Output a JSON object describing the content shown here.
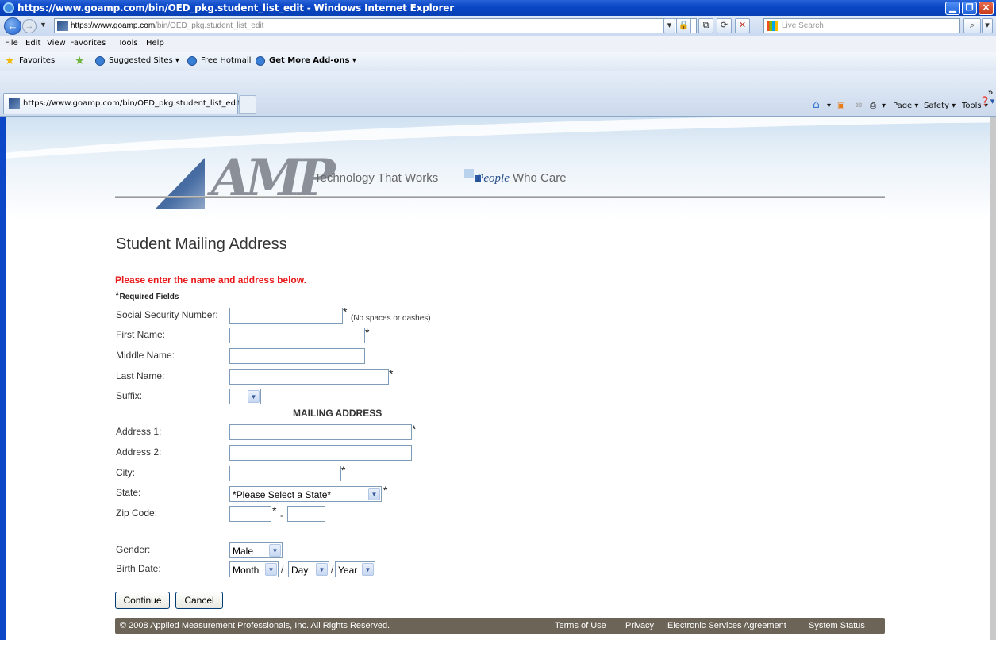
{
  "window": {
    "title": "https://www.goamp.com/bin/OED_pkg.student_list_edit - Windows Internet Explorer",
    "min_glyph": "▁",
    "max_glyph": "❐",
    "close_glyph": "✕"
  },
  "address_bar": {
    "url_prefix": "https://",
    "url_domain": "www.goamp.com",
    "url_path": "/bin/OED_pkg.student_list_edit",
    "search_placeholder": "Live Search"
  },
  "menu": [
    "File",
    "Edit",
    "View",
    "Favorites",
    "Tools",
    "Help"
  ],
  "favorites_bar": {
    "favorites_label": "Favorites",
    "suggested_sites": "Suggested Sites ▾",
    "free_hotmail": "Free Hotmail",
    "get_more_addons": "Get More Add-ons ▾"
  },
  "tab": {
    "label": "https://www.goamp.com/bin/OED_pkg.student_list_edit"
  },
  "command_bar": {
    "page": "Page ▾",
    "safety": "Safety ▾",
    "tools": "Tools ▾",
    "help": "❓▾",
    "more": "»"
  },
  "banner": {
    "logo_text": "AMP",
    "tagline_a": "Technology That Works",
    "tagline_b": "People",
    "tagline_c": " Who Care"
  },
  "form": {
    "heading": "Student Mailing Address",
    "instruction": "Please enter the name and address below.",
    "required_mark": "*",
    "required_label": "Required Fields",
    "ssn_label": "Social Security Number:",
    "ssn_hint": "(No spaces or dashes)",
    "first_name_label": "First Name:",
    "middle_name_label": "Middle Name:",
    "last_name_label": "Last Name:",
    "suffix_label": "Suffix:",
    "suffix_value": "",
    "section_title": "MAILING ADDRESS",
    "address1_label": "Address 1:",
    "address2_label": "Address 2:",
    "city_label": "City:",
    "state_label": "State:",
    "state_value": "*Please Select a State*",
    "zip_label": "Zip Code:",
    "zip_separator": "-",
    "gender_label": "Gender:",
    "gender_value": "Male",
    "birth_date_label": "Birth Date:",
    "month_value": "Month",
    "day_value": "Day",
    "year_value": "Year",
    "date_sep": "/",
    "continue_label": "Continue",
    "cancel_label": "Cancel"
  },
  "footer": {
    "copyright": "© 2008 Applied Measurement Professionals, Inc. All Rights Reserved.",
    "links": [
      "Terms of Use",
      "Privacy",
      "Electronic Services Agreement",
      "System Status"
    ]
  }
}
